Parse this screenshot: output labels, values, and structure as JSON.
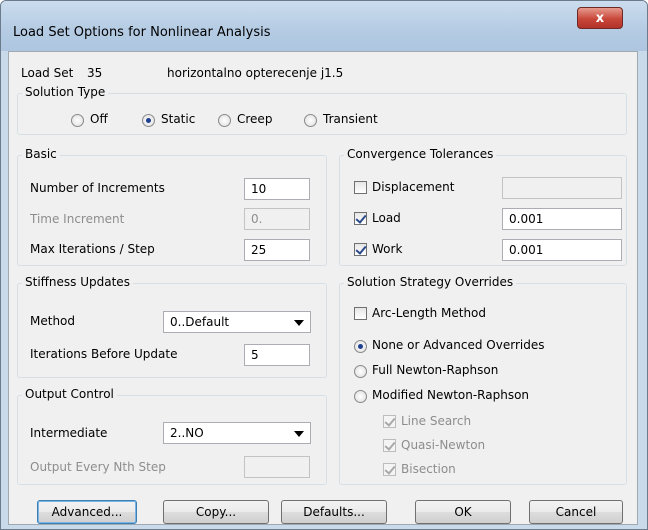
{
  "window": {
    "title": "Load Set Options for Nonlinear Analysis",
    "close_glyph": "x"
  },
  "load_set": {
    "label": "Load Set",
    "number": "35",
    "name": "horizontalno opterecenje j1.5"
  },
  "solution_type": {
    "title": "Solution Type",
    "options": [
      "Off",
      "Static",
      "Creep",
      "Transient"
    ],
    "selected": "Static"
  },
  "basic": {
    "title": "Basic",
    "num_increments_label": "Number of Increments",
    "num_increments": "10",
    "time_increment_label": "Time Increment",
    "time_increment": "0.",
    "max_iter_label": "Max Iterations / Step",
    "max_iter": "25"
  },
  "convergence": {
    "title": "Convergence Tolerances",
    "displacement_label": "Displacement",
    "displacement_checked": false,
    "displacement_value": "",
    "load_label": "Load",
    "load_checked": true,
    "load_value": "0.001",
    "work_label": "Work",
    "work_checked": true,
    "work_value": "0.001"
  },
  "stiffness": {
    "title": "Stiffness Updates",
    "method_label": "Method",
    "method_value": "0..Default",
    "iter_before_update_label": "Iterations Before Update",
    "iter_before_update": "5"
  },
  "strategy": {
    "title": "Solution Strategy Overrides",
    "arc_length_label": "Arc-Length Method",
    "arc_length_checked": false,
    "radio_none_label": "None or Advanced Overrides",
    "radio_full_label": "Full Newton-Raphson",
    "radio_modified_label": "Modified Newton-Raphson",
    "selected": "None or Advanced Overrides",
    "line_search_label": "Line Search",
    "quasi_newton_label": "Quasi-Newton",
    "bisection_label": "Bisection"
  },
  "output": {
    "title": "Output Control",
    "intermediate_label": "Intermediate",
    "intermediate_value": "2..NO",
    "every_nth_label": "Output Every Nth Step",
    "every_nth_value": ""
  },
  "buttons": {
    "advanced": "Advanced...",
    "copy": "Copy...",
    "defaults": "Defaults...",
    "ok": "OK",
    "cancel": "Cancel"
  },
  "colors": {
    "titlebar": "#b9cfe6",
    "close": "#c8473a",
    "panel": "#f0f0f0",
    "accent": "#3c7fb1"
  }
}
